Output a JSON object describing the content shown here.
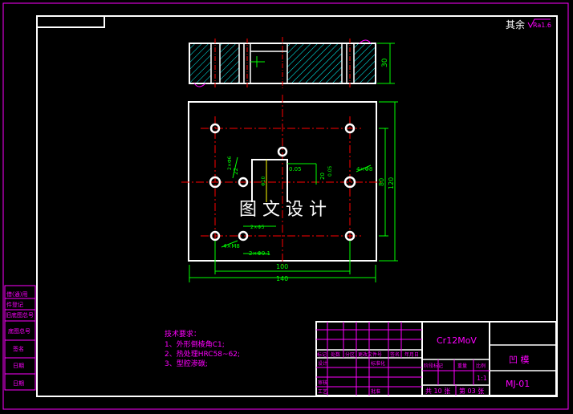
{
  "corner_note": {
    "prefix": "其余",
    "roughness": "Ra1.6"
  },
  "watermark": "图 文 设 计",
  "dims": {
    "top_height": "30",
    "side_inner": "80",
    "side_outer": "120",
    "bottom_inner": "100",
    "bottom_outer": "140",
    "slot_tol_a": "0.05",
    "slot_width": "20",
    "slot_tol_b": "0.05",
    "hole_left": "2×Φ6",
    "hole_right": "4×Φ8",
    "hole_bl": "4×M8",
    "hole_bottom": "2×Φ9.1",
    "hole_mid": "2×Φ5",
    "pin_dim": "Φ10",
    "slot_depth": "22"
  },
  "tech_requirements": {
    "title": "技术要求：",
    "items": [
      "1、外形倒棱角C1;",
      "2、热处理HRC58~62;",
      "3、型腔渗碳;"
    ]
  },
  "left_strip": [
    "借(通)用",
    "件登记",
    "旧底图总号",
    "底图总号",
    "签名",
    "日期",
    "日期"
  ],
  "title_block": {
    "material": "Cr12MoV",
    "part_name": "凹 模",
    "drawing_no": "MJ-01",
    "scale": "1:1",
    "sheet_total_label": "共 10 张",
    "sheet_no_label": "第 03 张",
    "rev_headers": [
      "标记",
      "处数",
      "分区",
      "更改文件号",
      "签名",
      "年月日"
    ],
    "role_design": "设计",
    "role_std": "标准化",
    "role_review": "审核",
    "role_craft": "工艺",
    "role_approve": "批准",
    "stage_headers": [
      "阶段标记",
      "重量",
      "比例"
    ]
  }
}
